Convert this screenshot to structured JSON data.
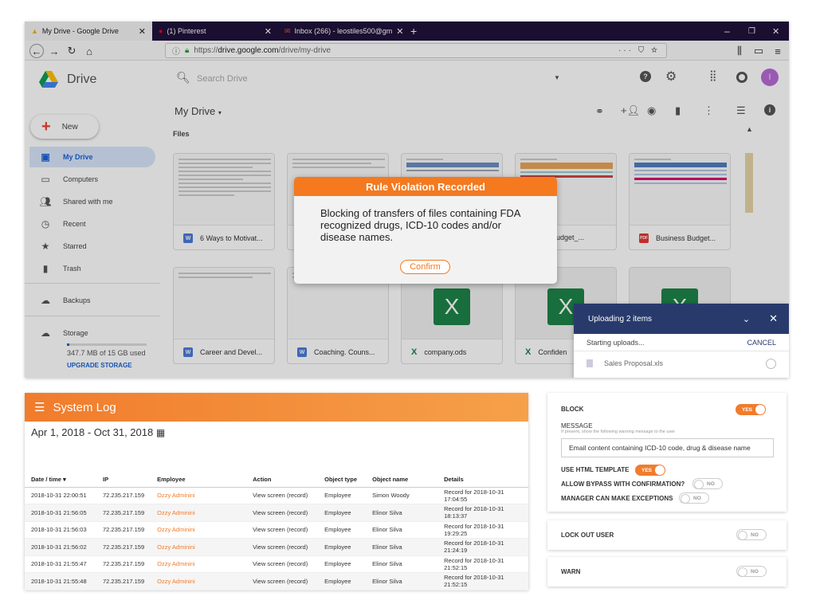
{
  "browser": {
    "tabs": [
      {
        "label": "My Drive - Google Drive",
        "close": "✕"
      },
      {
        "label": "(1) Pinterest",
        "close": "✕"
      },
      {
        "label": "Inbox (266) - leostiles500@gm",
        "close": "✕"
      }
    ],
    "new_tab": "+",
    "url_prefix": "https://",
    "url_domain": "drive.google.com",
    "url_path": "/drive/my-drive"
  },
  "drive": {
    "app_name": "Drive",
    "search_placeholder": "Search Drive",
    "new_button": "New",
    "avatar_letter": "l",
    "breadcrumb": "My Drive",
    "files_heading": "Files",
    "nav": [
      {
        "label": "My Drive",
        "icon": "drive-folder-icon"
      },
      {
        "label": "Computers",
        "icon": "computer-icon"
      },
      {
        "label": "Shared with me",
        "icon": "people-icon"
      },
      {
        "label": "Recent",
        "icon": "clock-icon"
      },
      {
        "label": "Starred",
        "icon": "star-icon"
      },
      {
        "label": "Trash",
        "icon": "trash-icon"
      },
      {
        "label": "Backups",
        "icon": "cloud-icon"
      },
      {
        "label": "Storage",
        "icon": "cloud-outline-icon"
      }
    ],
    "storage_used": "347.7 MB of 15 GB used",
    "upgrade": "UPGRADE STORAGE",
    "files_row1": [
      {
        "name": "6 Ways to Motivat...",
        "type": "W"
      },
      {
        "name": "",
        "type": ""
      },
      {
        "name": "",
        "type": ""
      },
      {
        "name": "usiness Budget_...",
        "type": ""
      },
      {
        "name": "Business Budget...",
        "type": "PDF"
      }
    ],
    "files_row2": [
      {
        "name": "Career and Devel...",
        "type": "W"
      },
      {
        "name": "Coaching. Couns...",
        "type": "W"
      },
      {
        "name": "company.ods",
        "type": "X"
      },
      {
        "name": "Confiden",
        "type": "X"
      }
    ]
  },
  "modal": {
    "title": "Rule Violation Recorded",
    "message": "Blocking of transfers of files containing FDA recognized drugs, ICD-10 codes and/or disease names.",
    "confirm": "Confirm"
  },
  "upload": {
    "title": "Uploading 2 items",
    "status": "Starting uploads...",
    "cancel": "CANCEL",
    "file": "Sales Proposal.xls"
  },
  "syslog": {
    "title": "System Log",
    "date_range": "Apr 1, 2018 - Oct 31, 2018",
    "columns": [
      "Date / time",
      "IP",
      "Employee",
      "Action",
      "Object type",
      "Object name",
      "Details"
    ],
    "rows": [
      [
        "2018-10-31 22:00:51",
        "72.235.217.159",
        "Ozzy Adminini",
        "View screen (record)",
        "Employee",
        "Simon Woody",
        "Record for 2018-10-31 17:04:55"
      ],
      [
        "2018-10-31 21:56:05",
        "72.235.217.159",
        "Ozzy Adminini",
        "View screen (record)",
        "Employee",
        "Elinor Silva",
        "Record for 2018-10-31 18:13:37"
      ],
      [
        "2018-10-31 21:56:03",
        "72.235.217.159",
        "Ozzy Adminini",
        "View screen (record)",
        "Employee",
        "Elinor Silva",
        "Record for 2018-10-31 19:29:25"
      ],
      [
        "2018-10-31 21:56:02",
        "72.235.217.159",
        "Ozzy Adminini",
        "View screen (record)",
        "Employee",
        "Elinor Silva",
        "Record for 2018-10-31 21:24:19"
      ],
      [
        "2018-10-31 21:55:47",
        "72.235.217.159",
        "Ozzy Adminini",
        "View screen (record)",
        "Employee",
        "Elinor Silva",
        "Record for 2018-10-31 21:52:15"
      ],
      [
        "2018-10-31 21:55:48",
        "72.235.217.159",
        "Ozzy Adminini",
        "View screen (record)",
        "Employee",
        "Elinor Silva",
        "Record for 2018-10-31 21:52:15"
      ]
    ]
  },
  "settings": {
    "block_label": "BLOCK",
    "block_value": "YES",
    "message_label": "MESSAGE",
    "message_hint": "If present, show the following warning message to the user",
    "message_value": "Email content containing ICD-10 code, drug & disease name",
    "html_template_label": "USE HTML TEMPLATE",
    "html_template_value": "YES",
    "bypass_label": "ALLOW BYPASS WITH CONFIRMATION?",
    "bypass_value": "NO",
    "manager_label": "MANAGER CAN MAKE EXCEPTIONS",
    "manager_value": "NO",
    "lockout_label": "LOCK OUT USER",
    "lockout_value": "NO",
    "warn_label": "WARN",
    "warn_value": "NO"
  },
  "colors": {
    "accent": "#f07c2c",
    "tabbar": "#20123a",
    "upload_header": "#283a6c",
    "excel": "#1d8348"
  }
}
